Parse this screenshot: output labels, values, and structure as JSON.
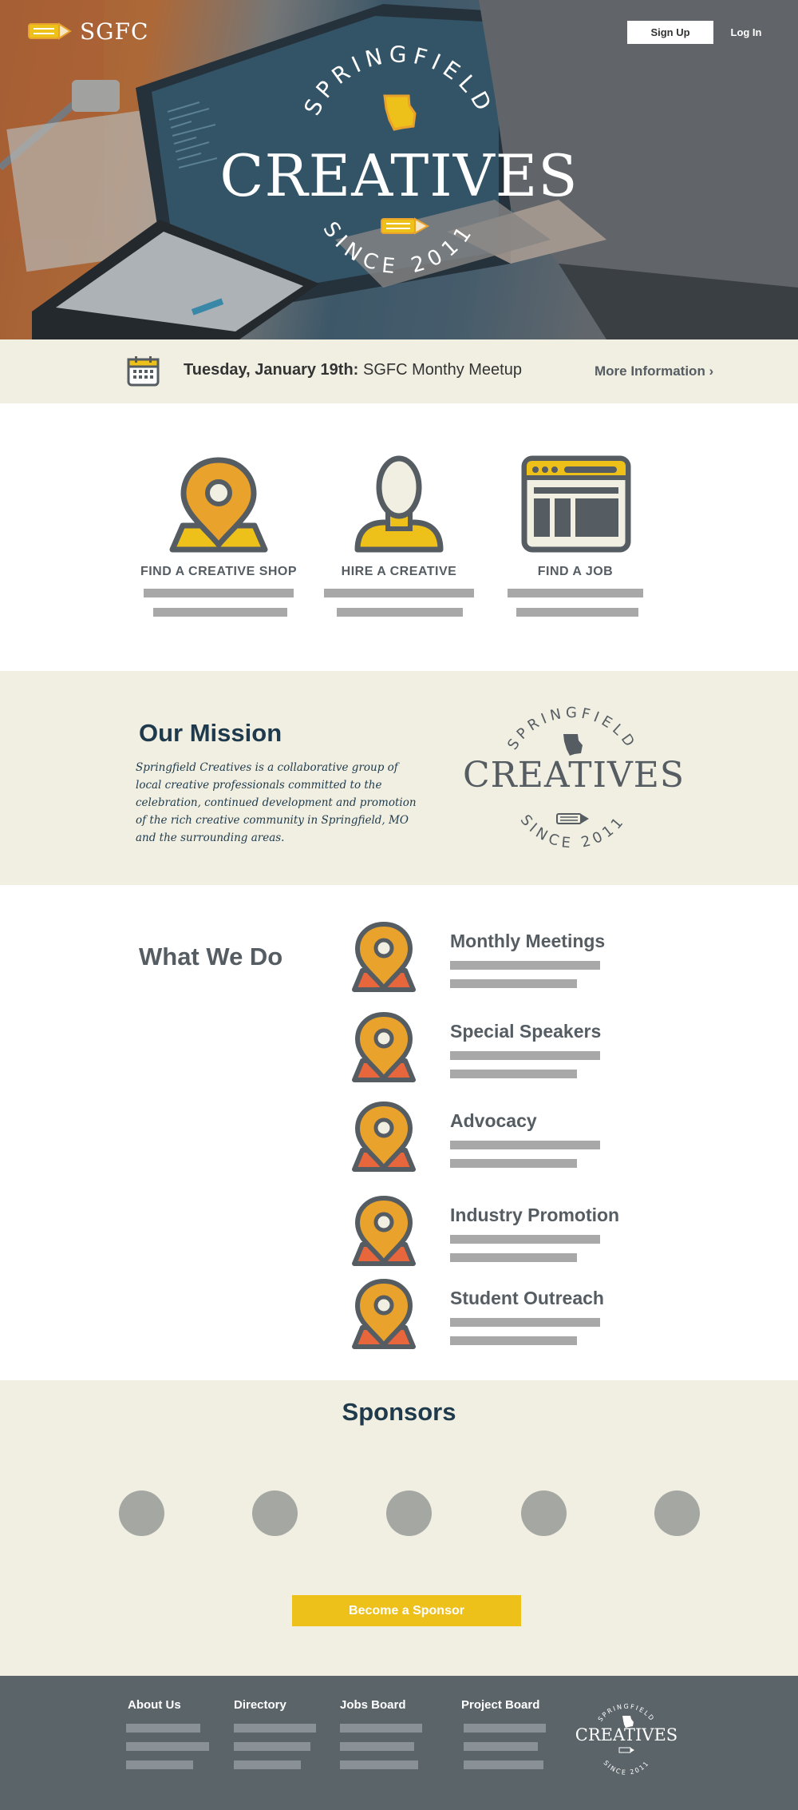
{
  "header": {
    "logo_text": "SGFC",
    "signup_label": "Sign Up",
    "login_label": "Log In"
  },
  "hero": {
    "arc_top": "SPRINGFIELD",
    "title": "CREATIVES",
    "arc_bottom": "SINCE 2011"
  },
  "event": {
    "date": "Tuesday, January 19th:",
    "name": "SGFC Monthy Meetup",
    "more_label": "More Information ›"
  },
  "features": [
    {
      "label": "FIND A CREATIVE SHOP",
      "icon": "map-pin-icon"
    },
    {
      "label": "HIRE A CREATIVE",
      "icon": "person-icon"
    },
    {
      "label": "FIND A JOB",
      "icon": "browser-window-icon"
    }
  ],
  "mission": {
    "title": "Our Mission",
    "text": "Springfield Creatives is a collaborative group of local creative professionals committed to the celebration, continued development and promotion of the rich creative community in Springfield, MO and the surrounding areas.",
    "emblem_arc_top": "SPRINGFIELD",
    "emblem_title": "CREATIVES",
    "emblem_arc_bottom": "SINCE 2011"
  },
  "what_we_do": {
    "title": "What We Do",
    "items": [
      {
        "name": "Monthly Meetings"
      },
      {
        "name": "Special Speakers"
      },
      {
        "name": "Advocacy"
      },
      {
        "name": "Industry Promotion"
      },
      {
        "name": "Student Outreach"
      }
    ]
  },
  "sponsors": {
    "title": "Sponsors",
    "count": 5,
    "button_label": "Become a Sponsor"
  },
  "footer": {
    "columns": [
      {
        "title": "About Us"
      },
      {
        "title": "Directory"
      },
      {
        "title": "Jobs Board"
      },
      {
        "title": "Project Board"
      }
    ],
    "emblem_arc_top": "SPRINGFIELD",
    "emblem_title": "CREATIVES",
    "emblem_arc_bottom": "SINCE 2011"
  },
  "colors": {
    "accent_yellow": "#eec01a",
    "pin_orange": "#e9a22b",
    "pin_red": "#e8663c",
    "navy": "#1e3a4c",
    "slate": "#555d63",
    "cream": "#f1efe2",
    "footer_bg": "#5b6469"
  }
}
